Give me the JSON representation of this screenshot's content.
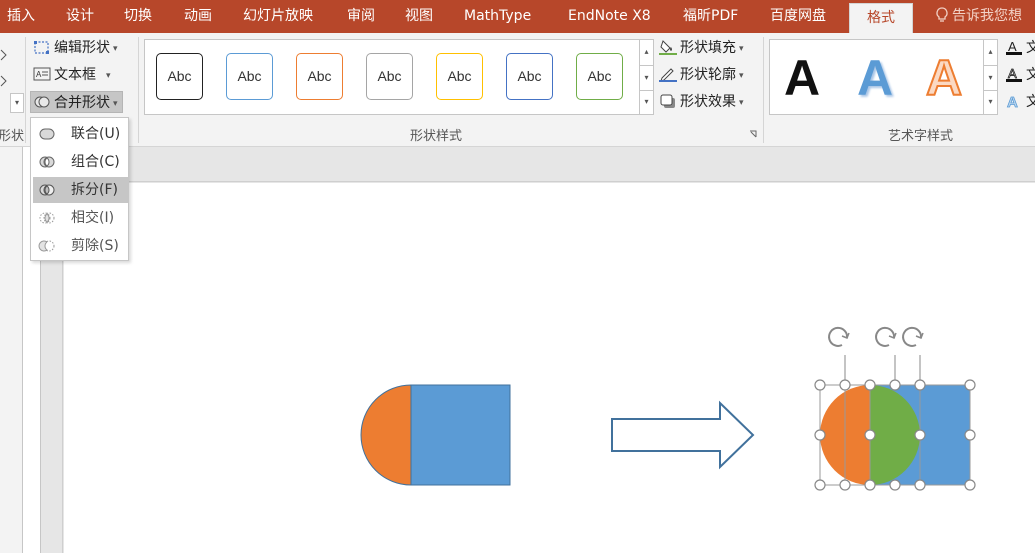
{
  "menu": {
    "tabs": [
      "插入",
      "设计",
      "切换",
      "动画",
      "幻灯片放映",
      "审阅",
      "视图",
      "MathType",
      "EndNote X8",
      "福昕PDF",
      "百度网盘",
      "格式"
    ],
    "tell_me": "告诉我您想"
  },
  "ribbon": {
    "left_edge_label": "形状",
    "insert_group": {
      "edit_shape": "编辑形状",
      "text_box": "文本框",
      "merge_shapes": "合并形状"
    },
    "shape_styles": {
      "label": "形状样式",
      "preset_text": "Abc",
      "fill": "形状填充",
      "outline": "形状轮廓",
      "effects": "形状效果"
    },
    "wordart_styles": {
      "label": "艺术字样式",
      "glyph": "A",
      "side_text": "文"
    }
  },
  "merge_menu": {
    "items": [
      {
        "label": "联合(U)",
        "state": "normal"
      },
      {
        "label": "组合(C)",
        "state": "normal"
      },
      {
        "label": "拆分(F)",
        "state": "hover"
      },
      {
        "label": "相交(I)",
        "state": "disabled"
      },
      {
        "label": "剪除(S)",
        "state": "disabled"
      }
    ]
  },
  "colors": {
    "tab_bar": "#b7472a",
    "orange_fill": "#ed7d31",
    "blue_fill": "#5b9bd5",
    "green_fill": "#70ad47",
    "arrow_outline": "#41719c"
  }
}
